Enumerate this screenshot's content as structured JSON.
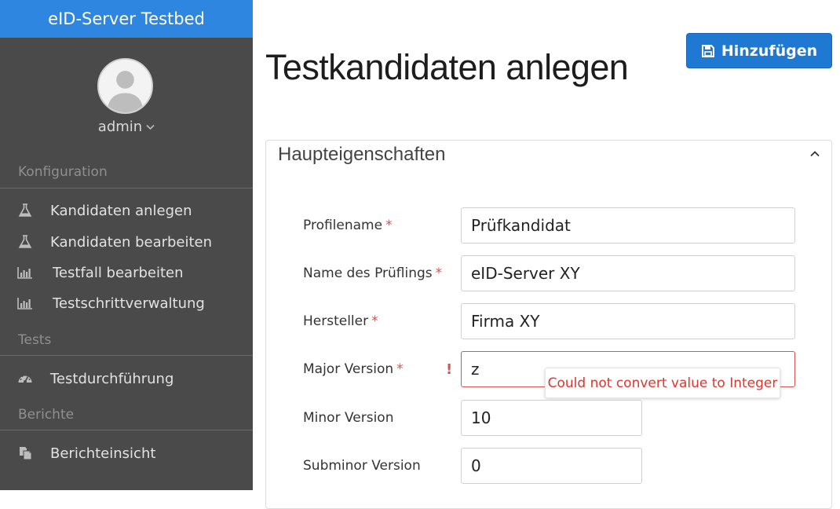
{
  "brand": {
    "part1": "eID-Server",
    "part2": "Testbed"
  },
  "user": {
    "name": "admin",
    "avatar_icon": "user-avatar-icon",
    "menu_icon": "chevron-down-icon"
  },
  "sidebar": {
    "sections": [
      {
        "label": "Konfiguration",
        "items": [
          {
            "label": "Kandidaten anlegen",
            "icon": "flask-icon"
          },
          {
            "label": "Kandidaten bearbeiten",
            "icon": "flask-icon"
          },
          {
            "label": "Testfall bearbeiten",
            "icon": "bar-chart-icon"
          },
          {
            "label": "Testschrittverwaltung",
            "icon": "bar-chart-icon"
          }
        ]
      },
      {
        "label": "Tests",
        "items": [
          {
            "label": "Testdurchführung",
            "icon": "dashboard-icon"
          }
        ]
      },
      {
        "label": "Berichte",
        "items": [
          {
            "label": "Berichteinsicht",
            "icon": "copy-icon"
          }
        ]
      }
    ]
  },
  "header": {
    "title": "Testkandidaten anlegen",
    "add_button": "Hinzufügen",
    "add_icon": "save-icon"
  },
  "panel": {
    "title": "Haupteigenschaften",
    "toggle_icon": "chevron-up-icon"
  },
  "form": {
    "required_marker": "*",
    "error_marker": "!",
    "fields": [
      {
        "label": "Profilename",
        "required": true,
        "value": "Prüfkandidat"
      },
      {
        "label": "Name des Prüflings",
        "required": true,
        "value": "eID-Server XY"
      },
      {
        "label": "Hersteller",
        "required": true,
        "value": "Firma XY"
      },
      {
        "label": "Major Version",
        "required": true,
        "value": "z",
        "error": "Could not convert value to Integer"
      },
      {
        "label": "Minor Version",
        "required": false,
        "value": "10"
      },
      {
        "label": "Subminor Version",
        "required": false,
        "value": "0"
      }
    ]
  },
  "colors": {
    "brand_blue": "#2f86e0",
    "sidebar_bg": "#4a4a4a",
    "button_blue": "#1f78d1",
    "error_red": "#d9534f"
  }
}
